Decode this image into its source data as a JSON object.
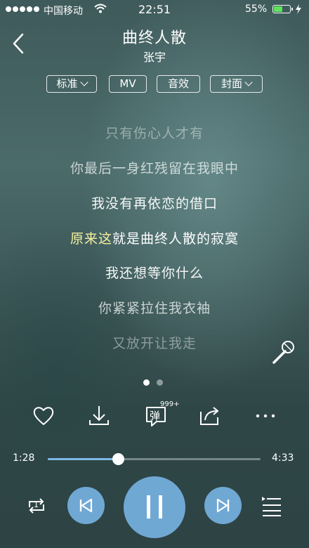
{
  "status": {
    "carrier": "中国移动",
    "time": "22:51",
    "battery_percent": "55%",
    "battery_level": 0.55,
    "battery_color": "#5ee35b"
  },
  "header": {
    "back_icon": "chevron-left-icon",
    "song_title": "曲终人散",
    "artist": "张宇"
  },
  "options": {
    "quality": "标准",
    "mv": "MV",
    "sound_effect": "音效",
    "cover": "封面"
  },
  "lyrics": {
    "lines": [
      "只有伤心人才有",
      "你最后一身红残留在我眼中",
      "我没有再依恋的借口",
      "原来这就是曲终人散的寂寞",
      "我还想等你什么",
      "你紧紧拉住我衣袖",
      "又放开让我走"
    ],
    "current_highlight": "原来这",
    "current_rest": "就是曲终人散的寂寞",
    "highlight_color": "#f5f0a0"
  },
  "mic_icon": "microphone-icon",
  "pager": {
    "count": 2,
    "active": 0
  },
  "actions": {
    "like_icon": "heart-icon",
    "download_icon": "download-icon",
    "danmu_label": "弹",
    "danmu_count": "999+",
    "share_icon": "share-icon",
    "more_icon": "more-icon"
  },
  "playback": {
    "current_time": "1:28",
    "total_time": "4:33",
    "progress": 0.33,
    "accent": "#7fb7e6"
  },
  "controls": {
    "repeat_label": "1",
    "repeat_icon": "repeat-one-icon",
    "prev_icon": "previous-icon",
    "pause_icon": "pause-icon",
    "next_icon": "next-icon",
    "playlist_icon": "playlist-icon",
    "button_color": "#70a8d4"
  }
}
